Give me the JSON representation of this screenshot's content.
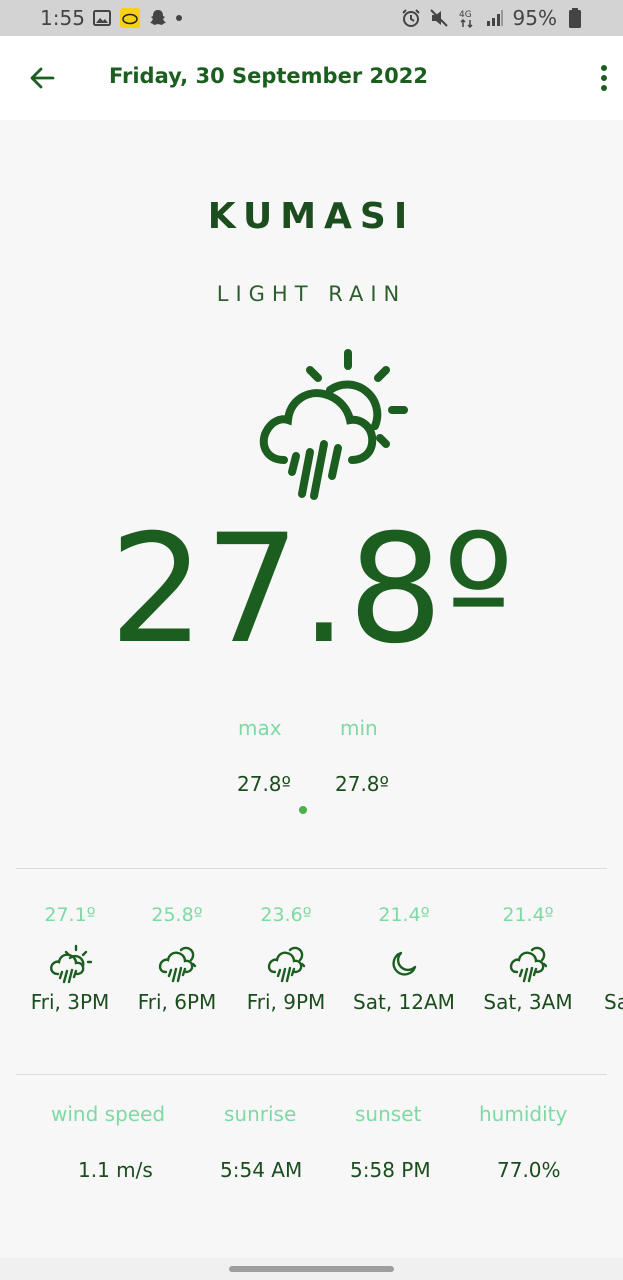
{
  "status_bar": {
    "time": "1:55",
    "battery": "95%",
    "icons_left": [
      "image-icon",
      "mtn-app-icon",
      "snapchat-icon",
      "dot-icon"
    ],
    "icons_right": [
      "alarm-icon",
      "mute-icon",
      "4g-icon",
      "signal-icon",
      "battery-icon"
    ]
  },
  "app_bar": {
    "title": "Friday, 30 September 2022"
  },
  "weather": {
    "city": "KUMASI",
    "condition": "LIGHT RAIN",
    "icon": "sun-cloud-rain-icon",
    "temperature": "27.8º",
    "max_label": "max",
    "min_label": "min",
    "max_value": "27.8º",
    "min_value": "27.8º"
  },
  "hourly": [
    {
      "temp": "27.1º",
      "label": "Fri, 3PM",
      "icon": "sun-cloud-rain-icon"
    },
    {
      "temp": "25.8º",
      "label": "Fri, 6PM",
      "icon": "cloud-rain-icon"
    },
    {
      "temp": "23.6º",
      "label": "Fri, 9PM",
      "icon": "cloud-rain-icon"
    },
    {
      "temp": "21.4º",
      "label": "Sat, 12AM",
      "icon": "moon-icon"
    },
    {
      "temp": "21.4º",
      "label": "Sat, 3AM",
      "icon": "cloud-rain-icon"
    },
    {
      "temp": "",
      "label": "Sa",
      "icon": ""
    }
  ],
  "details": {
    "wind_label": "wind speed",
    "wind_value": "1.1 m/s",
    "sunrise_label": "sunrise",
    "sunrise_value": "5:54 AM",
    "sunset_label": "sunset",
    "sunset_value": "5:58 PM",
    "humidity_label": "humidity",
    "humidity_value": "77.0%"
  },
  "colors": {
    "primary": "#1b5e20",
    "accent_light": "#7ed9a4",
    "background": "#f7f7f7"
  }
}
